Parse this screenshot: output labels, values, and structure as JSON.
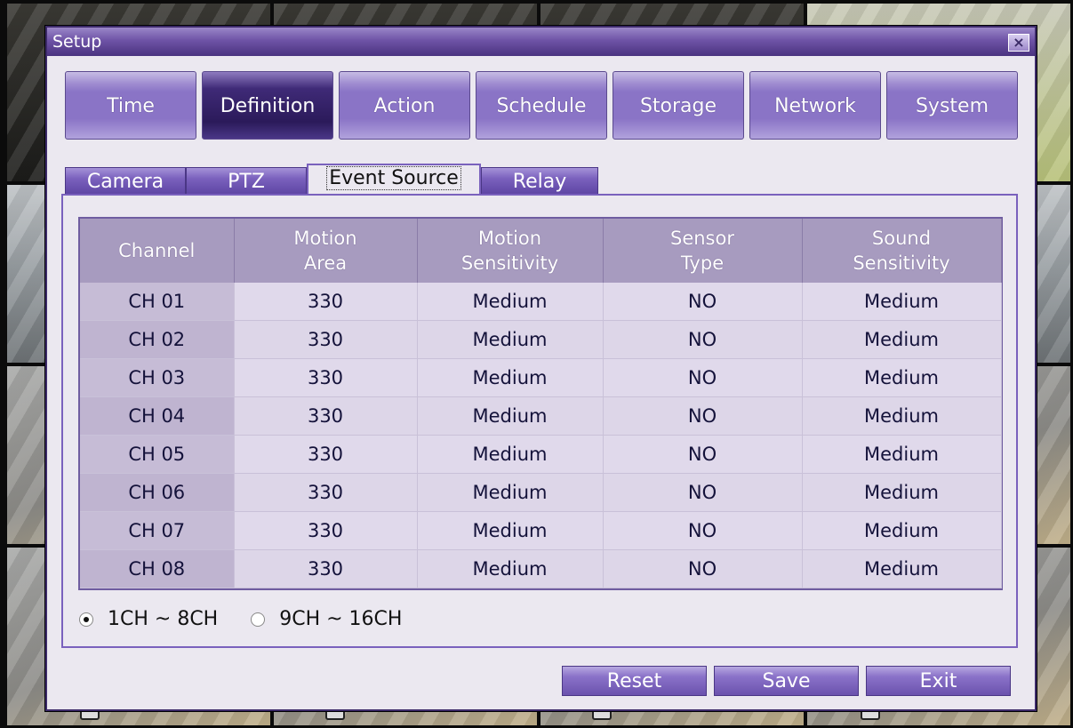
{
  "window": {
    "title": "Setup"
  },
  "main_tabs": [
    {
      "label": "Time"
    },
    {
      "label": "Definition"
    },
    {
      "label": "Action"
    },
    {
      "label": "Schedule"
    },
    {
      "label": "Storage"
    },
    {
      "label": "Network"
    },
    {
      "label": "System"
    }
  ],
  "active_main_tab": "Definition",
  "sub_tabs": [
    {
      "label": "Camera"
    },
    {
      "label": "PTZ"
    },
    {
      "label": "Event Source"
    },
    {
      "label": "Relay"
    }
  ],
  "active_sub_tab": "Event Source",
  "table": {
    "headers": [
      {
        "line1": "Channel",
        "line2": ""
      },
      {
        "line1": "Motion",
        "line2": "Area"
      },
      {
        "line1": "Motion",
        "line2": "Sensitivity"
      },
      {
        "line1": "Sensor",
        "line2": "Type"
      },
      {
        "line1": "Sound",
        "line2": "Sensitivity"
      }
    ],
    "rows": [
      [
        "CH 01",
        "330",
        "Medium",
        "NO",
        "Medium"
      ],
      [
        "CH 02",
        "330",
        "Medium",
        "NO",
        "Medium"
      ],
      [
        "CH 03",
        "330",
        "Medium",
        "NO",
        "Medium"
      ],
      [
        "CH 04",
        "330",
        "Medium",
        "NO",
        "Medium"
      ],
      [
        "CH 05",
        "330",
        "Medium",
        "NO",
        "Medium"
      ],
      [
        "CH 06",
        "330",
        "Medium",
        "NO",
        "Medium"
      ],
      [
        "CH 07",
        "330",
        "Medium",
        "NO",
        "Medium"
      ],
      [
        "CH 08",
        "330",
        "Medium",
        "NO",
        "Medium"
      ]
    ]
  },
  "channel_range": {
    "options": [
      {
        "label": "1CH ~ 8CH",
        "selected": true
      },
      {
        "label": "9CH ~ 16CH",
        "selected": false
      }
    ]
  },
  "buttons": {
    "reset": "Reset",
    "save": "Save",
    "exit": "Exit"
  },
  "colors": {
    "accent": "#7a61bd",
    "active_tab": "#2b1a5a",
    "header_bg": "#a79bbf"
  }
}
